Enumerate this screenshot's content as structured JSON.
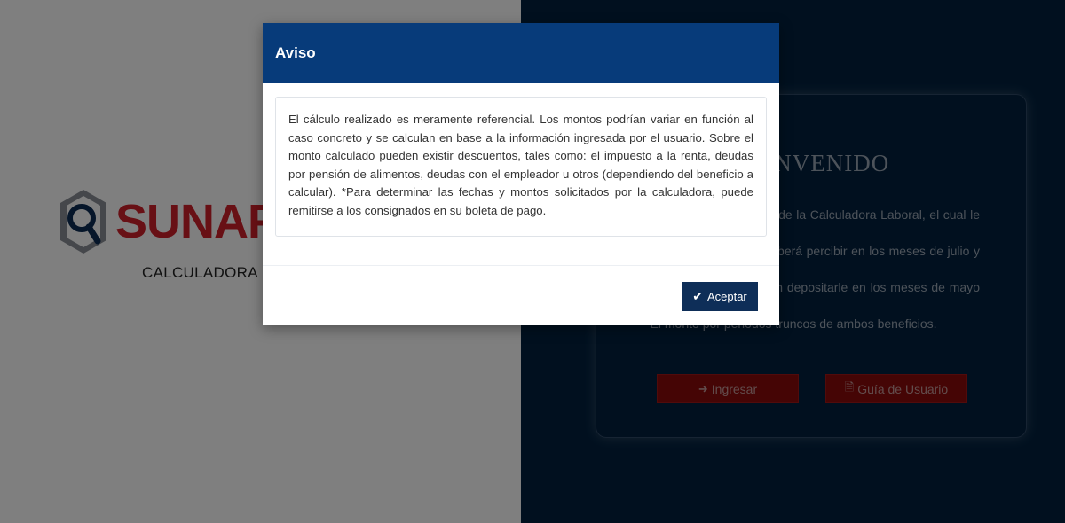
{
  "left": {
    "logo_text": "SUNAFIL",
    "subtitle": "CALCULADORA LABORAL"
  },
  "welcome": {
    "title": "BIENVENIDO",
    "intro": "Bienvenido al Aplicativo de la Calculadora Laboral, el cual le ayudará a calcular:",
    "items": [
      "- La gratificación que deberá percibir en los meses de julio y diciembre.",
      "- La CTS que le deberán depositarle en los meses de mayo y noviembre.",
      "- El monto por periodos truncos de ambos beneficios."
    ],
    "login_label": "Ingresar",
    "login_icon": "sign-in-icon",
    "guide_label": "Guía de Usuario",
    "guide_icon": "pdf-file-icon"
  },
  "modal": {
    "title": "Aviso",
    "body": "El cálculo realizado es meramente referencial. Los montos podrían variar en función al caso concreto y se calculan en base a la información ingresada por el usuario. Sobre el monto calculado pueden existir descuentos, tales como: el impuesto a la renta, deudas por pensión de alimentos, deudas con el empleador u otros (dependiendo del beneficio a calcular). *Para determinar las fechas y montos solicitados por la calculadora, puede remitirse a los consignados en su boleta de pago.",
    "accept_label": "Aceptar",
    "accept_icon": "check-icon"
  },
  "colors": {
    "modal_header": "#073b7a",
    "right_panel": "#02213f",
    "brand_red": "#d0202b",
    "accept_button": "#0e2e58"
  }
}
